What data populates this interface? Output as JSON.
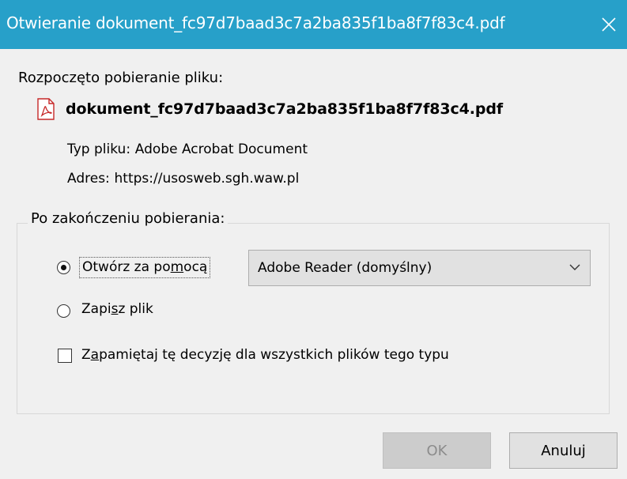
{
  "window": {
    "title": "Otwieranie dokument_fc97d7baad3c7a2ba835f1ba8f7f83c4.pdf",
    "close_icon": "close-icon",
    "titlebar_color": "#27a0c9"
  },
  "intro_text": "Rozpoczęto pobieranie pliku:",
  "file": {
    "icon": "pdf-file-icon",
    "name": "dokument_fc97d7baad3c7a2ba835f1ba8f7f83c4.pdf",
    "type_label": "Typ pliku:",
    "type_value": "Adobe Acrobat Document",
    "address_label": "Adres:",
    "address_value": "https://usosweb.sgh.waw.pl"
  },
  "after_download": {
    "group_label": "Po zakończeniu pobierania:",
    "open_with": {
      "label_before": "Otwórz za po",
      "label_accel": "m",
      "label_after": "ocą",
      "selected": true
    },
    "app_select": {
      "value": "Adobe Reader  (domyślny)"
    },
    "save_file": {
      "label_before": "Zapi",
      "label_accel": "s",
      "label_after": "z plik",
      "selected": false
    },
    "remember": {
      "label_before": "Z",
      "label_accel": "a",
      "label_after": "pamiętaj tę decyzję dla wszystkich plików tego typu",
      "checked": false
    }
  },
  "buttons": {
    "ok_label": "OK",
    "ok_enabled": false,
    "cancel_label": "Anuluj"
  }
}
